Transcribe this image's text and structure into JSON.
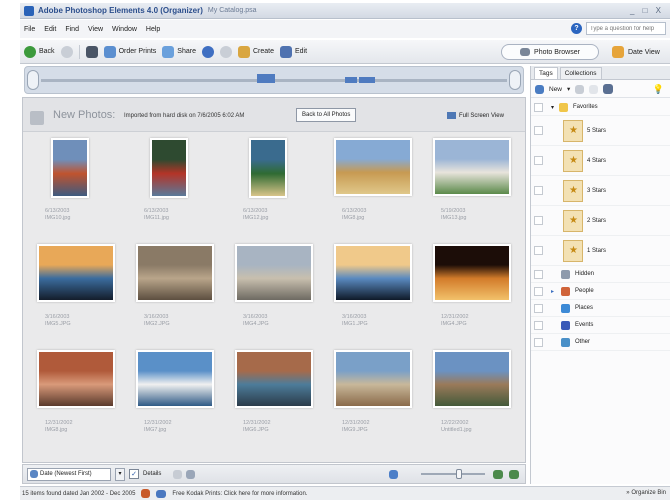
{
  "window": {
    "title": "Adobe Photoshop Elements 4.0 (Organizer)",
    "subtitle": "My Catalog.psa",
    "controls": "_ □ X"
  },
  "menu": [
    "File",
    "Edit",
    "Find",
    "View",
    "Window",
    "Help"
  ],
  "help": {
    "placeholder": "Type a question for help"
  },
  "toolbar": {
    "back": "Back",
    "order_prints": "Order Prints",
    "share": "Share",
    "create": "Create",
    "edit": "Edit",
    "photo_browser": "Photo Browser",
    "date_view": "Date View"
  },
  "new_photos": {
    "title": "New Photos:",
    "description": "Imported from hard disk on 7/6/2005 6:02 AM",
    "back_button": "Back to All Photos",
    "full_screen": "Full Screen View"
  },
  "photos": [
    {
      "date": "6/13/2003",
      "name": "IMG10.jpg",
      "colors": [
        "#6f8fba",
        "#c0532e",
        "#3d5a80"
      ],
      "orientation": "portrait"
    },
    {
      "date": "6/13/2003",
      "name": "IMG11.jpg",
      "colors": [
        "#2e4a30",
        "#b43427",
        "#5a7a9a"
      ],
      "orientation": "portrait"
    },
    {
      "date": "6/13/2003",
      "name": "IMG12.jpg",
      "colors": [
        "#3a6b8e",
        "#2f6b32",
        "#d8c48a"
      ],
      "orientation": "portrait"
    },
    {
      "date": "6/13/2003",
      "name": "IMG8.jpg",
      "colors": [
        "#86aad4",
        "#c79a52",
        "#e0c88a"
      ],
      "orientation": "landscape"
    },
    {
      "date": "5/19/2003",
      "name": "IMG13.jpg",
      "colors": [
        "#9bb5d6",
        "#e8e4dc",
        "#5b8a4a"
      ],
      "orientation": "landscape"
    },
    {
      "date": "3/16/2003",
      "name": "IMG5.JPG",
      "colors": [
        "#e8a858",
        "#3b6c9e",
        "#141d2b"
      ],
      "orientation": "landscape"
    },
    {
      "date": "3/16/2003",
      "name": "IMG2.JPG",
      "colors": [
        "#8a7a66",
        "#b9a58a",
        "#5d4f40"
      ],
      "orientation": "landscape"
    },
    {
      "date": "3/16/2003",
      "name": "IMG4.JPG",
      "colors": [
        "#a8b4c2",
        "#c8bfae",
        "#6e6a62"
      ],
      "orientation": "landscape"
    },
    {
      "date": "3/16/2003",
      "name": "IMG1.JPG",
      "colors": [
        "#f0c98a",
        "#5a8ac0",
        "#0f1a28"
      ],
      "orientation": "landscape"
    },
    {
      "date": "12/31/2002",
      "name": "IMG4.JPG",
      "colors": [
        "#1c0d08",
        "#d27b2a",
        "#f2c16b"
      ],
      "orientation": "landscape"
    },
    {
      "date": "12/31/2002",
      "name": "IMG8.jpg",
      "colors": [
        "#b05a3a",
        "#d99a7a",
        "#5a3a2c"
      ],
      "orientation": "landscape"
    },
    {
      "date": "12/31/2002",
      "name": "IMG7.jpg",
      "colors": [
        "#5a90c8",
        "#f0f0f0",
        "#2f5a86"
      ],
      "orientation": "landscape"
    },
    {
      "date": "12/31/2002",
      "name": "IMG6.JPG",
      "colors": [
        "#a66a4a",
        "#4d7c9a",
        "#2b3b4a"
      ],
      "orientation": "landscape"
    },
    {
      "date": "12/31/2002",
      "name": "IMG9.JPG",
      "colors": [
        "#7aa0c8",
        "#c8b89a",
        "#8a6a4a"
      ],
      "orientation": "landscape"
    },
    {
      "date": "12/22/2002",
      "name": "Untitled1.jpg",
      "colors": [
        "#6b92c2",
        "#9a7a5a",
        "#445a3a"
      ],
      "orientation": "landscape"
    }
  ],
  "bottom": {
    "sort": "Date (Newest First)",
    "details": "Details",
    "zoom_level": 0.6
  },
  "status": {
    "found": "15 items found dated Jan 2002 - Dec 2005",
    "kodak": "Free Kodak Prints: Click here for more information.",
    "organize_bin": "Organize Bin"
  },
  "panel": {
    "tabs": [
      "Tags",
      "Collections"
    ],
    "new_label": "New",
    "tags": [
      {
        "label": "Favorites",
        "type": "folder"
      },
      {
        "label": "5 Stars",
        "type": "star"
      },
      {
        "label": "4 Stars",
        "type": "star"
      },
      {
        "label": "3 Stars",
        "type": "star"
      },
      {
        "label": "2 Stars",
        "type": "star"
      },
      {
        "label": "1 Stars",
        "type": "star"
      },
      {
        "label": "Hidden",
        "type": "category",
        "color": "#8e9aac"
      },
      {
        "label": "People",
        "type": "category",
        "color": "#d0643a"
      },
      {
        "label": "Places",
        "type": "category",
        "color": "#3d8ad6"
      },
      {
        "label": "Events",
        "type": "category",
        "color": "#3a5ab8"
      },
      {
        "label": "Other",
        "type": "category",
        "color": "#4a90c8"
      }
    ]
  }
}
